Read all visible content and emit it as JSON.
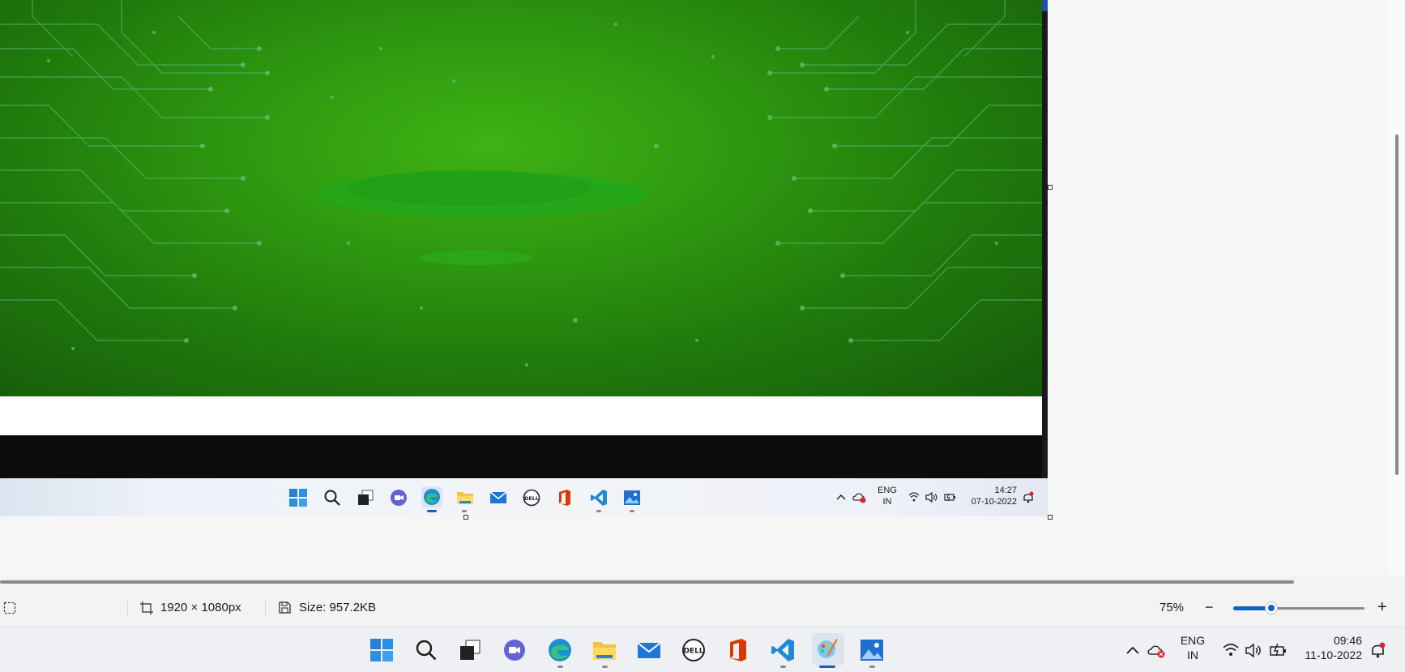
{
  "canvas": {
    "image_blurred": true
  },
  "inner_screenshot": {
    "taskbar": {
      "icons": [
        "windows-start-icon",
        "search-icon",
        "task-view-icon",
        "teams-chat-icon",
        "edge-icon",
        "file-explorer-icon",
        "mail-icon",
        "dell-icon",
        "office-icon",
        "vscode-icon",
        "photos-icon"
      ],
      "tray": {
        "language": "ENG",
        "region": "IN",
        "time": "14:27",
        "date": "07-10-2022"
      }
    }
  },
  "statusbar": {
    "dimensions": "1920 × 1080px",
    "size": "Size: 957.2KB",
    "zoom": "75%",
    "zoom_level_fraction": 0.29,
    "zoom_out_label": "−",
    "zoom_in_label": "+"
  },
  "taskbar": {
    "apps": [
      "windows-start",
      "search",
      "task-view",
      "teams-chat",
      "edge",
      "file-explorer",
      "mail",
      "dell",
      "office",
      "vscode",
      "paint",
      "photos"
    ],
    "tray": {
      "language": "ENG",
      "region": "IN",
      "time": "09:46",
      "date": "11-10-2022"
    }
  },
  "colors": {
    "accent": "#0b63c6",
    "image_green": "#2f9a10"
  }
}
